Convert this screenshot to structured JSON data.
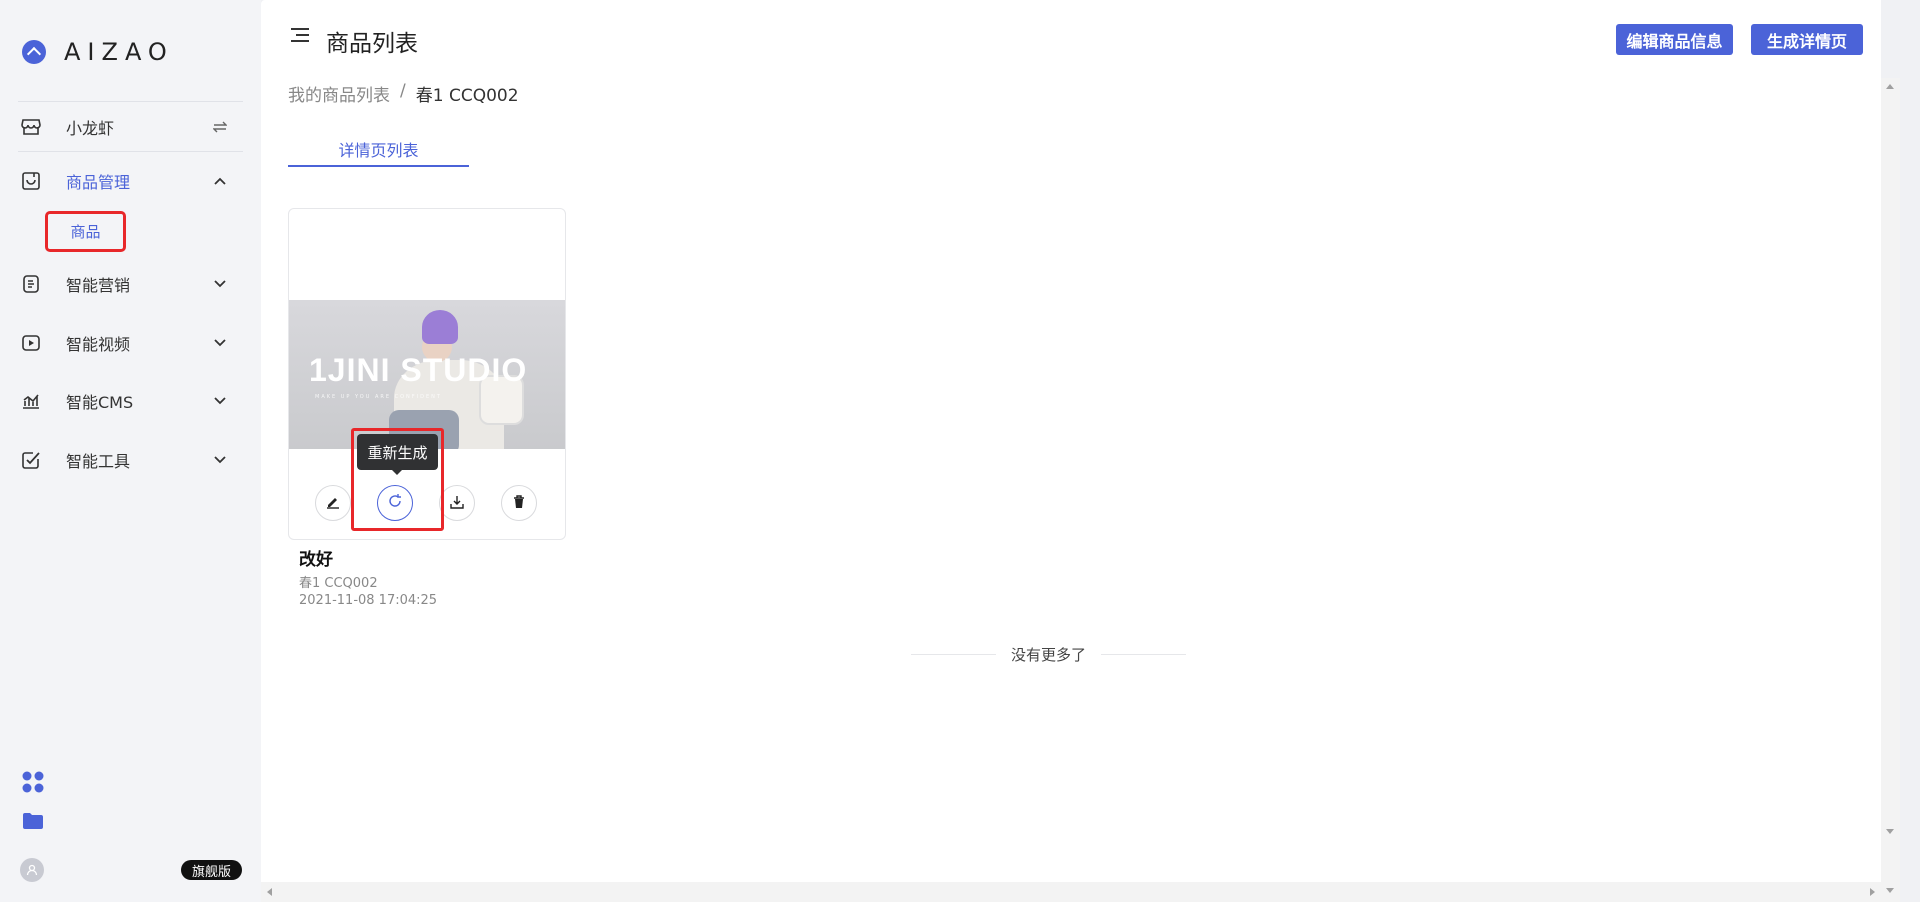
{
  "app": {
    "logo_text": "AIZAO"
  },
  "sidebar": {
    "store": {
      "label": "小龙虾",
      "icon": "store-icon",
      "switch_icon": "switch-icon"
    },
    "items": [
      {
        "label": "商品管理",
        "icon": "product-manage-icon",
        "expanded": true,
        "children": [
          {
            "label": "商品"
          }
        ]
      },
      {
        "label": "智能营销",
        "icon": "marketing-icon",
        "expanded": false
      },
      {
        "label": "智能视频",
        "icon": "video-icon",
        "expanded": false
      },
      {
        "label": "智能CMS",
        "icon": "cms-icon",
        "expanded": false
      },
      {
        "label": "智能工具",
        "icon": "tools-icon",
        "expanded": false
      }
    ],
    "bottom": {
      "apps_icon": "apps-grid-icon",
      "folder_icon": "folder-icon",
      "avatar_icon": "user-avatar-icon",
      "plan_badge": "旗舰版"
    }
  },
  "header": {
    "title": "商品列表",
    "buttons": {
      "edit_info": "编辑商品信息",
      "generate_detail": "生成详情页"
    }
  },
  "breadcrumb": {
    "parent": "我的商品列表",
    "separator": "/",
    "current": "春1 CCQ002"
  },
  "tabs": [
    {
      "label": "详情页列表",
      "active": true
    }
  ],
  "card": {
    "image": {
      "brand_text": "1JINI STUDIO",
      "sub_text": "MAKE UP YOU ARE CONFIDENT"
    },
    "actions": [
      "edit-icon",
      "regenerate-icon",
      "download-icon",
      "delete-icon"
    ],
    "tooltip": "重新生成",
    "title": "改好",
    "subtitle": "春1 CCQ002",
    "timestamp": "2021-11-08 17:04:25"
  },
  "list_footer": {
    "no_more": "没有更多了"
  },
  "colors": {
    "accent": "#4b63d8",
    "highlight_box": "#e8272a",
    "tooltip_bg": "#303133"
  }
}
